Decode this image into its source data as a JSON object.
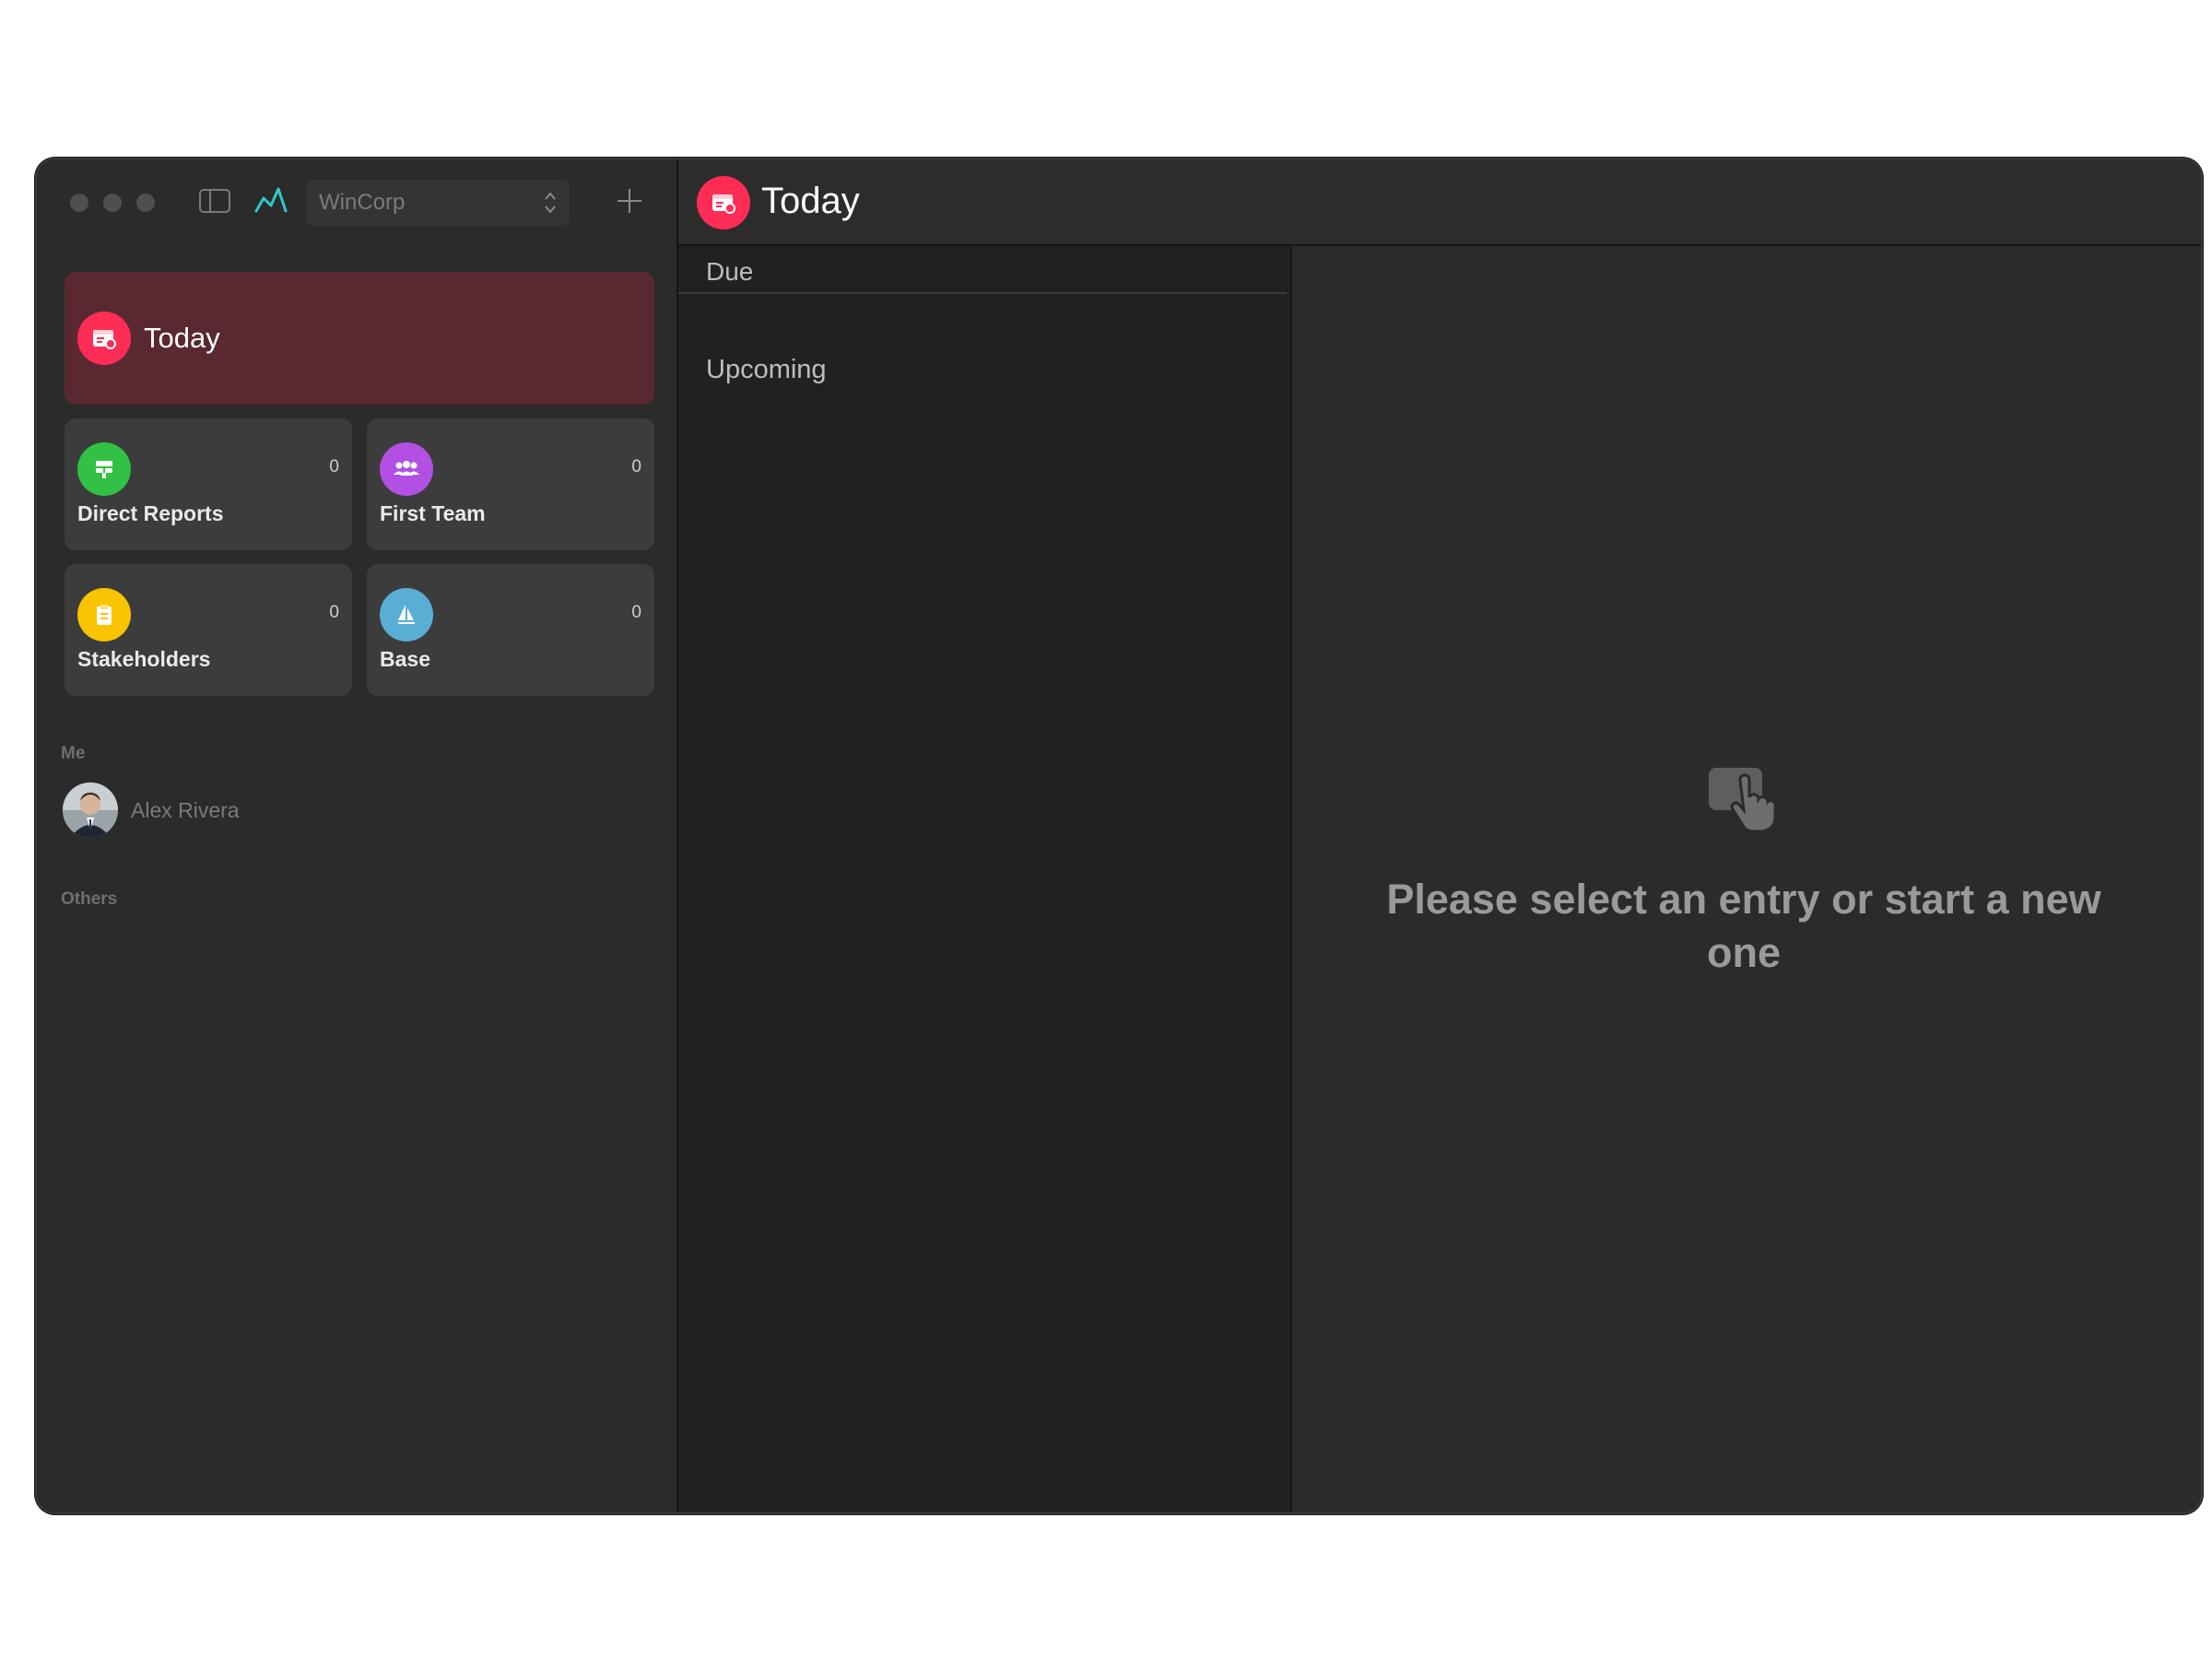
{
  "window": {
    "workspace": "WinCorp"
  },
  "sidebar": {
    "today": {
      "label": "Today",
      "icon": "calendar-badge-icon",
      "color": "#ff2d55"
    },
    "tiles": [
      {
        "label": "Direct Reports",
        "count": "0",
        "icon": "org-chart-icon",
        "color": "#30c146"
      },
      {
        "label": "First Team",
        "count": "0",
        "icon": "group-icon",
        "color": "#b150e2"
      },
      {
        "label": "Stakeholders",
        "count": "0",
        "icon": "clipboard-icon",
        "color": "#f8c400"
      },
      {
        "label": "Base",
        "count": "0",
        "icon": "sailboat-icon",
        "color": "#5aaed3"
      }
    ],
    "me_header": "Me",
    "me_name": "Alex Rivera",
    "others_header": "Others"
  },
  "main": {
    "title": "Today",
    "groups": {
      "due": "Due",
      "upcoming": "Upcoming"
    },
    "empty_state": "Please select an entry or start a new one"
  }
}
